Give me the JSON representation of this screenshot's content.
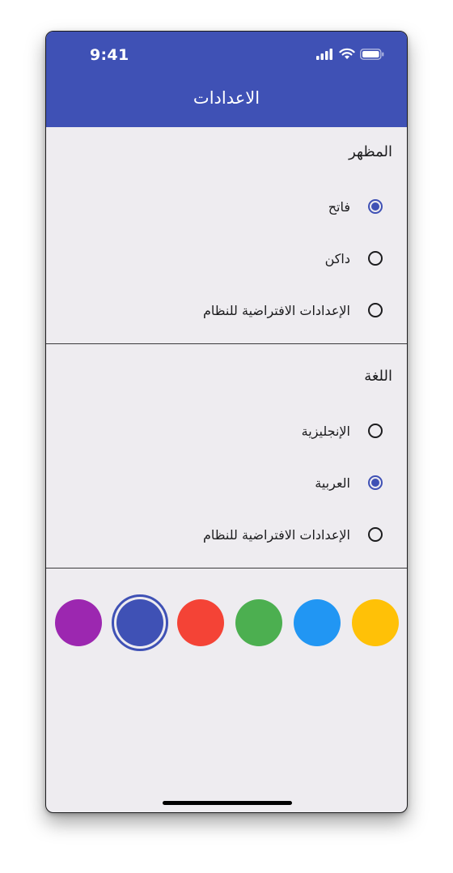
{
  "status_bar": {
    "time": "9:41",
    "icons": [
      "cellular-signal-icon",
      "wifi-icon",
      "battery-icon"
    ]
  },
  "app_bar": {
    "title": "الاعدادات",
    "color": "#3f51b5"
  },
  "appearance": {
    "title": "المظهر",
    "options": [
      {
        "label": "فاتح",
        "selected": true
      },
      {
        "label": "داكن",
        "selected": false
      },
      {
        "label": "الإعدادات الافتراضية للنظام",
        "selected": false
      }
    ]
  },
  "language": {
    "title": "اللغة",
    "options": [
      {
        "label": "الإنجليزية",
        "selected": false
      },
      {
        "label": "العربية",
        "selected": true
      },
      {
        "label": "الإعدادات الافتراضية للنظام",
        "selected": false
      }
    ]
  },
  "colors": {
    "swatches": [
      {
        "name": "purple",
        "hex": "#9c27b0",
        "selected": false
      },
      {
        "name": "indigo",
        "hex": "#3f51b5",
        "selected": true
      },
      {
        "name": "red",
        "hex": "#f44336",
        "selected": false
      },
      {
        "name": "green",
        "hex": "#4caf50",
        "selected": false
      },
      {
        "name": "blue",
        "hex": "#2196f3",
        "selected": false
      },
      {
        "name": "amber",
        "hex": "#ffc107",
        "selected": false
      }
    ]
  }
}
